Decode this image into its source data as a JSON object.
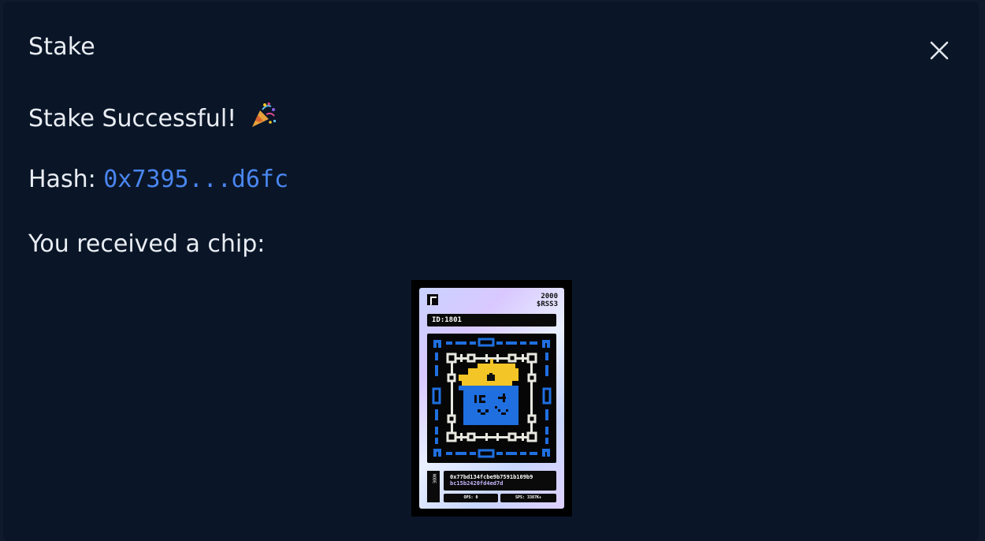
{
  "modal": {
    "title": "Stake",
    "success_text": "Stake Successful!",
    "hash_label": "Hash:",
    "hash_value": "0x7395...d6fc",
    "received_text": "You received a chip:"
  },
  "icons": {
    "close": "close-icon",
    "party": "party-popper-icon"
  },
  "colors": {
    "background": "#0a1628",
    "text": "#e9edf3",
    "link": "#4a86f0",
    "chip_pixel_blue": "#1f6fe0",
    "chip_pixel_yellow": "#f4c526"
  },
  "chip": {
    "amount": "2000",
    "token": "$RSS3",
    "id": "ID:1801",
    "node_label": "NODE",
    "address_line1": "0x77bd134fcbe9b7591b109b9",
    "address_line2": "bc15b2420fd4ed7d",
    "ops": "OPS: 0",
    "sps": "SPS: 3387K+"
  }
}
